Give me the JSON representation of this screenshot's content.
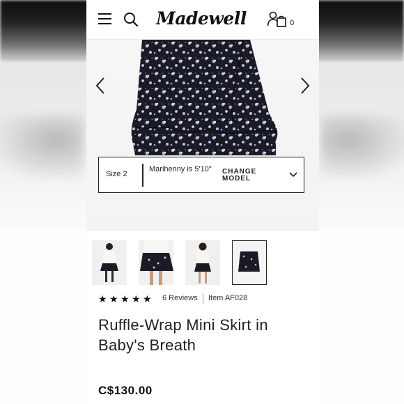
{
  "header": {
    "logo_text": "Madewell",
    "cart_count": "0",
    "icons": [
      "menu-icon",
      "search-icon",
      "account-icon",
      "bag-icon"
    ]
  },
  "gallery": {
    "nav_icons": [
      "chevron-left-icon",
      "chevron-right-icon"
    ]
  },
  "model_info": {
    "size": "Size 2",
    "model_text": "Marihenny is 5'10\"",
    "change_label": "CHANGE MODEL"
  },
  "thumbnails": [
    {
      "alt": "front view"
    },
    {
      "alt": "detail view"
    },
    {
      "alt": "back view"
    },
    {
      "alt": "flat lay"
    }
  ],
  "rating": {
    "stars": 5,
    "reviews_label": "6 Reviews",
    "item_label": "Item AF028"
  },
  "product": {
    "title": "Ruffle-Wrap Mini Skirt in Baby's Breath",
    "price": "C$130.00"
  },
  "colors": {
    "skirt": "#1c1a24",
    "flower": "#b8c7e6",
    "text": "#222222"
  }
}
